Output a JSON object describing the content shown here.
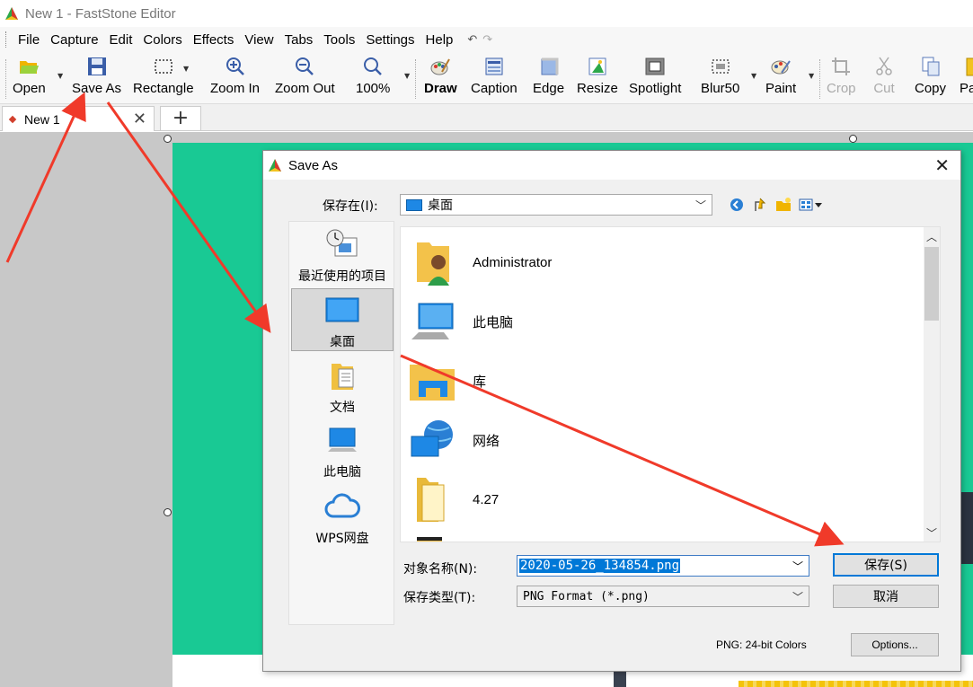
{
  "window": {
    "title": "New 1 - FastStone Editor"
  },
  "menu": [
    "File",
    "Capture",
    "Edit",
    "Colors",
    "Effects",
    "View",
    "Tabs",
    "Tools",
    "Settings",
    "Help"
  ],
  "toolbar": {
    "open": "Open",
    "save_as": "Save As",
    "rectangle": "Rectangle",
    "zoom_in": "Zoom In",
    "zoom_out": "Zoom Out",
    "zoom_level": "100%",
    "draw": "Draw",
    "caption": "Caption",
    "edge": "Edge",
    "resize": "Resize",
    "spotlight": "Spotlight",
    "blur": "Blur50",
    "paint": "Paint",
    "crop": "Crop",
    "cut": "Cut",
    "copy": "Copy",
    "paste_partial": "Pa"
  },
  "tabs": {
    "active": "New 1",
    "add": "+"
  },
  "dialog": {
    "title": "Save As",
    "save_in_label": "保存在(I):",
    "save_in_value": "桌面",
    "places": [
      "最近使用的项目",
      "桌面",
      "文档",
      "此电脑",
      "WPS网盘"
    ],
    "files": [
      "Administrator",
      "此电脑",
      "库",
      "网络",
      "4.27"
    ],
    "filename_label": "对象名称(N):",
    "filename_value": "2020-05-26_134854.png",
    "filetype_label": "保存类型(T):",
    "filetype_value": "PNG Format (*.png)",
    "save_button": "保存(S)",
    "cancel_button": "取消",
    "status": "PNG: 24-bit Colors",
    "options_button": "Options..."
  },
  "colors": {
    "accent_green": "#19c994",
    "arrow_red": "#f03a2a",
    "select_blue": "#0078d7"
  }
}
